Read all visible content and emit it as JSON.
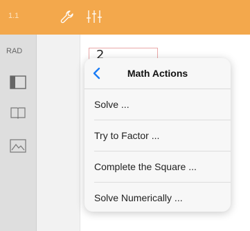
{
  "topbar": {
    "tab_number": "1.1",
    "tools_icon": "wrench-icon",
    "settings_icon": "sliders-icon",
    "color": "#f3a84c"
  },
  "sidebar": {
    "mode_label": "RAD",
    "icons": [
      "layout-icon",
      "book-icon",
      "graph-icon"
    ]
  },
  "document": {
    "entry_text": "2"
  },
  "popover": {
    "title": "Math Actions",
    "back_icon": "chevron-left-icon",
    "accent": "#1a7cf5",
    "items": [
      {
        "label": "Solve ..."
      },
      {
        "label": "Try to Factor ..."
      },
      {
        "label": "Complete the Square ..."
      },
      {
        "label": "Solve Numerically ..."
      }
    ]
  }
}
